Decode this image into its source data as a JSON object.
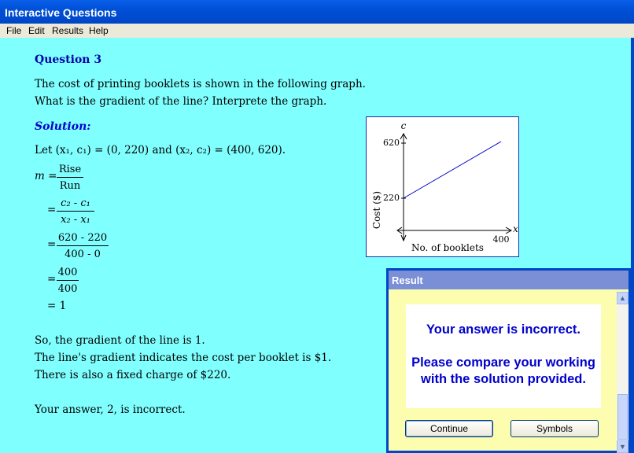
{
  "window": {
    "title": "Interactive Questions"
  },
  "menu": [
    "File",
    "Edit",
    "Results",
    "Help"
  ],
  "question": {
    "title": "Question 3",
    "line1": "The cost of printing booklets is shown in the following graph.",
    "line2": "What is the gradient of the line?  Interprete the graph."
  },
  "solution": {
    "title": "Solution:",
    "let_line": "Let (x₁, c₁) = (0, 220) and (x₂, c₂) = (400, 620).",
    "m_label": "m =",
    "eq": "=",
    "frac1": {
      "num": "Rise",
      "den": "Run"
    },
    "frac2": {
      "num": "c₂ - c₁",
      "den": "x₂ - x₁"
    },
    "frac3": {
      "num": "620 - 220",
      "den": "400 - 0"
    },
    "frac4": {
      "num": "400",
      "den": "400"
    },
    "result": "= 1",
    "conclusion1": "So, the gradient of the line is 1.",
    "conclusion2": "The line's gradient indicates the cost per booklet is $1.",
    "conclusion3": "There is also a fixed charge of $220.",
    "your_answer": "Your answer, 2, is incorrect."
  },
  "graph": {
    "y_axis_var": "c",
    "x_axis_var": "x",
    "y_label": "Cost ($)",
    "x_label": "No. of booklets",
    "tick_620": "620",
    "tick_220": "220",
    "tick_400": "400",
    "line_color": "#0000cc"
  },
  "dialog": {
    "title": "Result",
    "msg1": "Your answer is incorrect.",
    "msg2": "Please compare your working",
    "msg3": "with the solution provided.",
    "continue_label": "Continue",
    "symbols_label": "Symbols"
  }
}
